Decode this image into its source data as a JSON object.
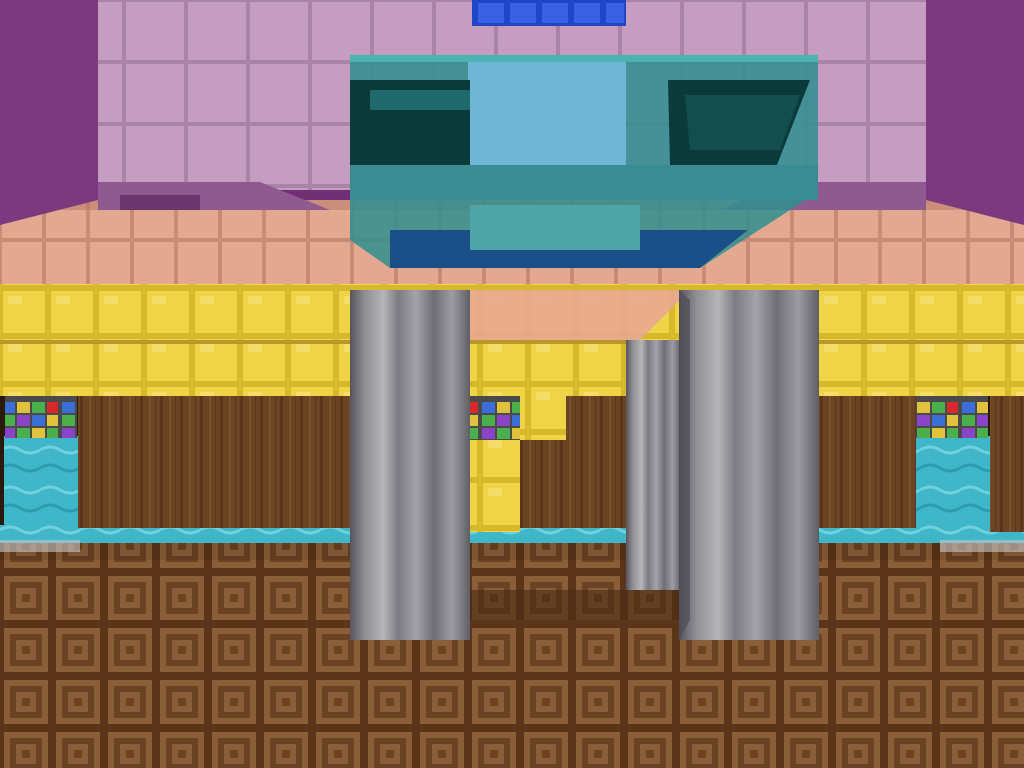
{
  "scene": {
    "type": "voxel-game-first-person-view",
    "hud_text": "",
    "palette": {
      "ceiling_pink": "#c79bbf",
      "ceiling_purple": "#a978a6",
      "trim_salmon": "#e0a08c",
      "gold_block": "#e8cc3c",
      "back_wall_wood": "#6b4424",
      "water": "#3fb7c9",
      "floor_wood": "#7a5232",
      "pillar_steel": "#8d8d93",
      "glass_cyan": "#2f8f8f",
      "lamp_blue": "#2145c7"
    },
    "blocks": [
      {
        "name": "ceiling-block",
        "material": "purple-stone"
      },
      {
        "name": "overhead-lamp",
        "material": "blue-lamp"
      },
      {
        "name": "glass-fixture",
        "material": "cyan-glass"
      },
      {
        "name": "trim-band",
        "material": "salmon-terracotta"
      },
      {
        "name": "gold-wall",
        "material": "gold-block"
      },
      {
        "name": "wood-wall",
        "material": "oak-planks"
      },
      {
        "name": "water-pool",
        "material": "water"
      },
      {
        "name": "multicolor-block",
        "material": "stained-tiles"
      },
      {
        "name": "floor",
        "material": "wooden-parquet"
      },
      {
        "name": "pillar",
        "material": "iron"
      }
    ]
  }
}
